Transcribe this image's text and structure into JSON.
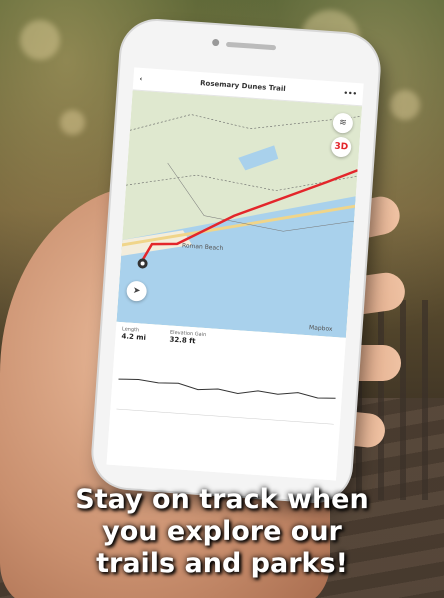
{
  "app": {
    "trail_title": "Rosemary Dunes Trail",
    "back_icon": "chevron-left-icon",
    "more_icon": "more-dots-icon",
    "threed_label": "3D",
    "place_label": "Roman Beach",
    "map_attribution": "Mapbox",
    "stats": {
      "length_label": "Length",
      "length_value": "4.2 mi",
      "elevation_label": "Elevation Gain",
      "elevation_value": "32.8 ft"
    }
  },
  "caption": {
    "line1": "Stay on track when",
    "line2": "you explore our",
    "line3": "trails and parks!"
  },
  "colors": {
    "route": "#e3262b",
    "water": "#a9d1ec",
    "land": "#dfe8cf"
  }
}
